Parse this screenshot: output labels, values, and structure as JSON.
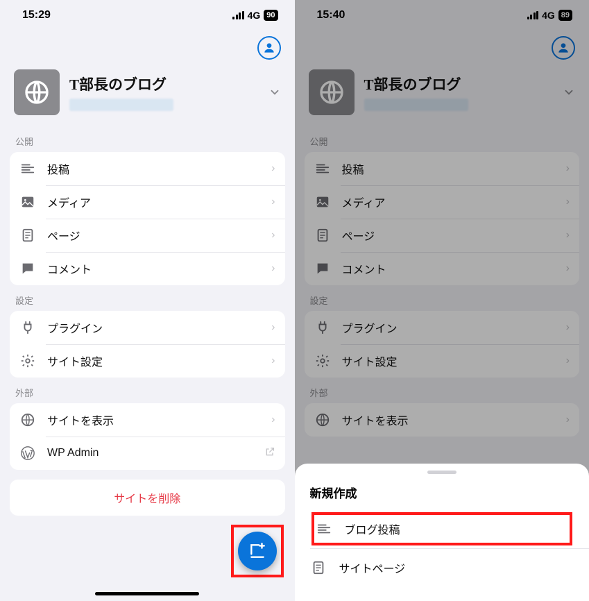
{
  "left": {
    "status": {
      "time": "15:29",
      "network": "4G",
      "battery": "90"
    },
    "site_title": "T部長のブログ",
    "sections": {
      "publish": {
        "label": "公開",
        "items": [
          {
            "name": "posts",
            "label": "投稿"
          },
          {
            "name": "media",
            "label": "メディア"
          },
          {
            "name": "pages",
            "label": "ページ"
          },
          {
            "name": "comments",
            "label": "コメント"
          }
        ]
      },
      "settings": {
        "label": "設定",
        "items": [
          {
            "name": "plugins",
            "label": "プラグイン"
          },
          {
            "name": "site-settings",
            "label": "サイト設定"
          }
        ]
      },
      "external": {
        "label": "外部",
        "items": [
          {
            "name": "view-site",
            "label": "サイトを表示"
          },
          {
            "name": "wp-admin",
            "label": "WP Admin"
          }
        ]
      }
    },
    "delete_site": "サイトを削除"
  },
  "right": {
    "status": {
      "time": "15:40",
      "network": "4G",
      "battery": "89"
    },
    "site_title": "T部長のブログ",
    "sections": {
      "publish": {
        "label": "公開",
        "items": [
          {
            "name": "posts",
            "label": "投稿"
          },
          {
            "name": "media",
            "label": "メディア"
          },
          {
            "name": "pages",
            "label": "ページ"
          },
          {
            "name": "comments",
            "label": "コメント"
          }
        ]
      },
      "settings": {
        "label": "設定",
        "items": [
          {
            "name": "plugins",
            "label": "プラグイン"
          },
          {
            "name": "site-settings",
            "label": "サイト設定"
          }
        ]
      },
      "external": {
        "label": "外部",
        "items": [
          {
            "name": "view-site",
            "label": "サイトを表示"
          }
        ]
      }
    },
    "sheet": {
      "title": "新規作成",
      "items": [
        {
          "name": "blog-post",
          "label": "ブログ投稿"
        },
        {
          "name": "site-page",
          "label": "サイトページ"
        }
      ]
    }
  }
}
